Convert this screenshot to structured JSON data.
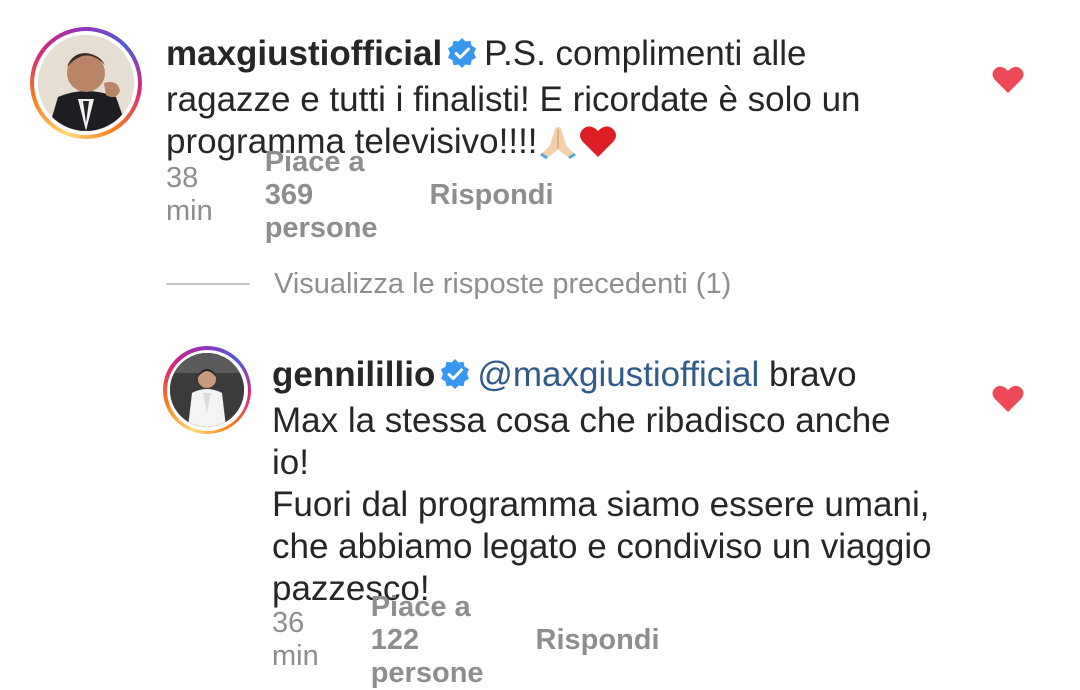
{
  "comments": [
    {
      "username": "maxgiustiofficial",
      "text_lines": [
        "P.S. complimenti alle",
        "ragazze e tutti i finalisti! E ricordate è solo un",
        "programma televisivo!!!!"
      ],
      "emojis": [
        "folded-hands-icon",
        "red-heart-icon"
      ],
      "time": "38 min",
      "likes": "Piace a 369 persone",
      "reply": "Rispondi",
      "liked": true
    },
    {
      "username": "gennilillio",
      "mention": "@maxgiustiofficial",
      "text_first": "bravo",
      "text_lines": [
        "Max la stessa cosa che ribadisco anche",
        "io!",
        "Fuori dal programma siamo essere umani,",
        "che abbiamo legato e condiviso un viaggio",
        "pazzesco!"
      ],
      "time": "36 min",
      "likes": "Piace a 122 persone",
      "reply": "Rispondi",
      "liked": true
    }
  ],
  "view_previous": "Visualizza le risposte precedenti (1)",
  "colors": {
    "text": "#262626",
    "meta": "#8e8e8e",
    "heart": "#ed4956",
    "verified": "#3897f0",
    "mention": "#2f5a8a"
  }
}
